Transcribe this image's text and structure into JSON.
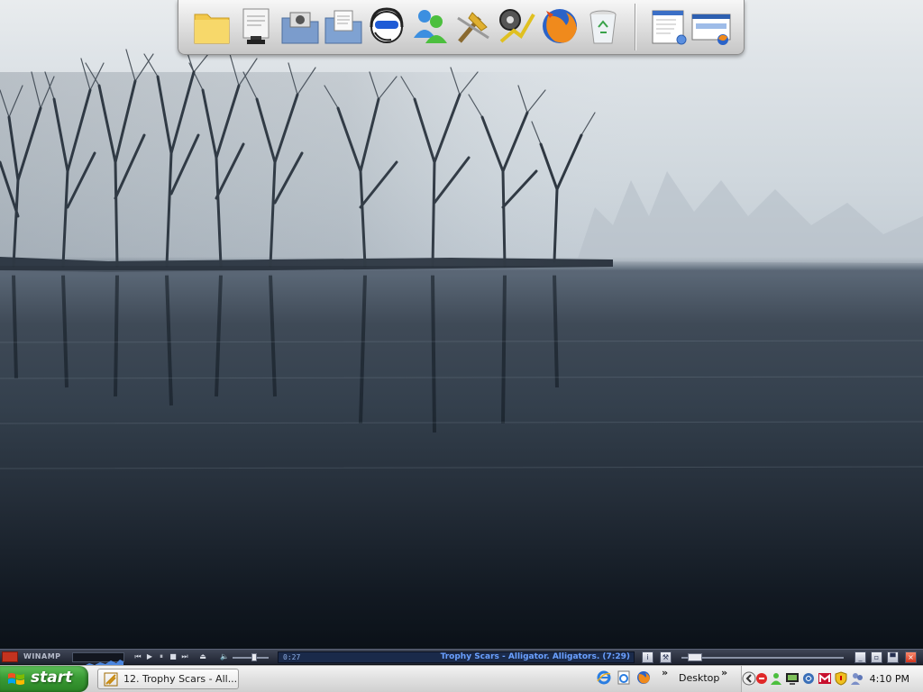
{
  "dock": {
    "apps": [
      {
        "name": "folder-icon"
      },
      {
        "name": "document-stamp-icon"
      },
      {
        "name": "pictures-folder-icon"
      },
      {
        "name": "documents-folder-icon"
      },
      {
        "name": "headset-support-icon"
      },
      {
        "name": "messenger-buddies-icon"
      },
      {
        "name": "tools-hammer-icon"
      },
      {
        "name": "system-monitor-icon"
      },
      {
        "name": "firefox-icon"
      },
      {
        "name": "recycle-bin-icon"
      },
      {
        "name": "window-preview-icon"
      },
      {
        "name": "browser-preview-icon"
      }
    ]
  },
  "winamp": {
    "title": "WINAMP",
    "time": "0:27",
    "song": "Trophy Scars - Alligator. Alligators. (7:29)",
    "volume_percent": 60,
    "seek_fraction": 0.04,
    "controls": [
      "prev",
      "play",
      "pause",
      "stop",
      "next",
      "eject"
    ]
  },
  "taskbar": {
    "start_label": "start",
    "task_label": "12. Trophy Scars - All...",
    "desktop_label": "Desktop",
    "clock": "4:10 PM",
    "quick_launch": [
      "internet-explorer-icon",
      "ie-page-icon",
      "firefox-icon"
    ],
    "tray": [
      "back-arrow-icon",
      "stop-icon",
      "user-icon",
      "monitor-icon",
      "network-icon",
      "gmail-icon",
      "shield-icon",
      "people-icon"
    ]
  },
  "colors": {
    "start_green": "#3a9b35",
    "winamp_song": "#6aa0ff"
  }
}
